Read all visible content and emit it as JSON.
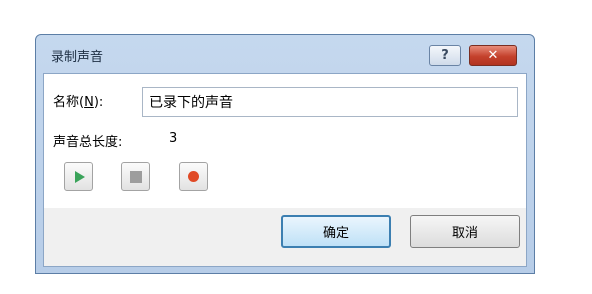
{
  "dialog": {
    "title": "录制声音",
    "help_glyph": "?",
    "close_glyph": "✕"
  },
  "form": {
    "name_label_prefix": "名称(",
    "name_label_accel": "N",
    "name_label_suffix": "):",
    "name_value": "已录下的声音",
    "length_label": "声音总长度:",
    "length_value": "3"
  },
  "media": {
    "play_icon": "play-icon",
    "stop_icon": "stop-icon",
    "record_icon": "record-icon",
    "colors": {
      "play": "#3aa35a",
      "stop": "#9d9d9d",
      "record": "#e04a26"
    }
  },
  "buttons": {
    "ok": "确定",
    "cancel": "取消"
  }
}
